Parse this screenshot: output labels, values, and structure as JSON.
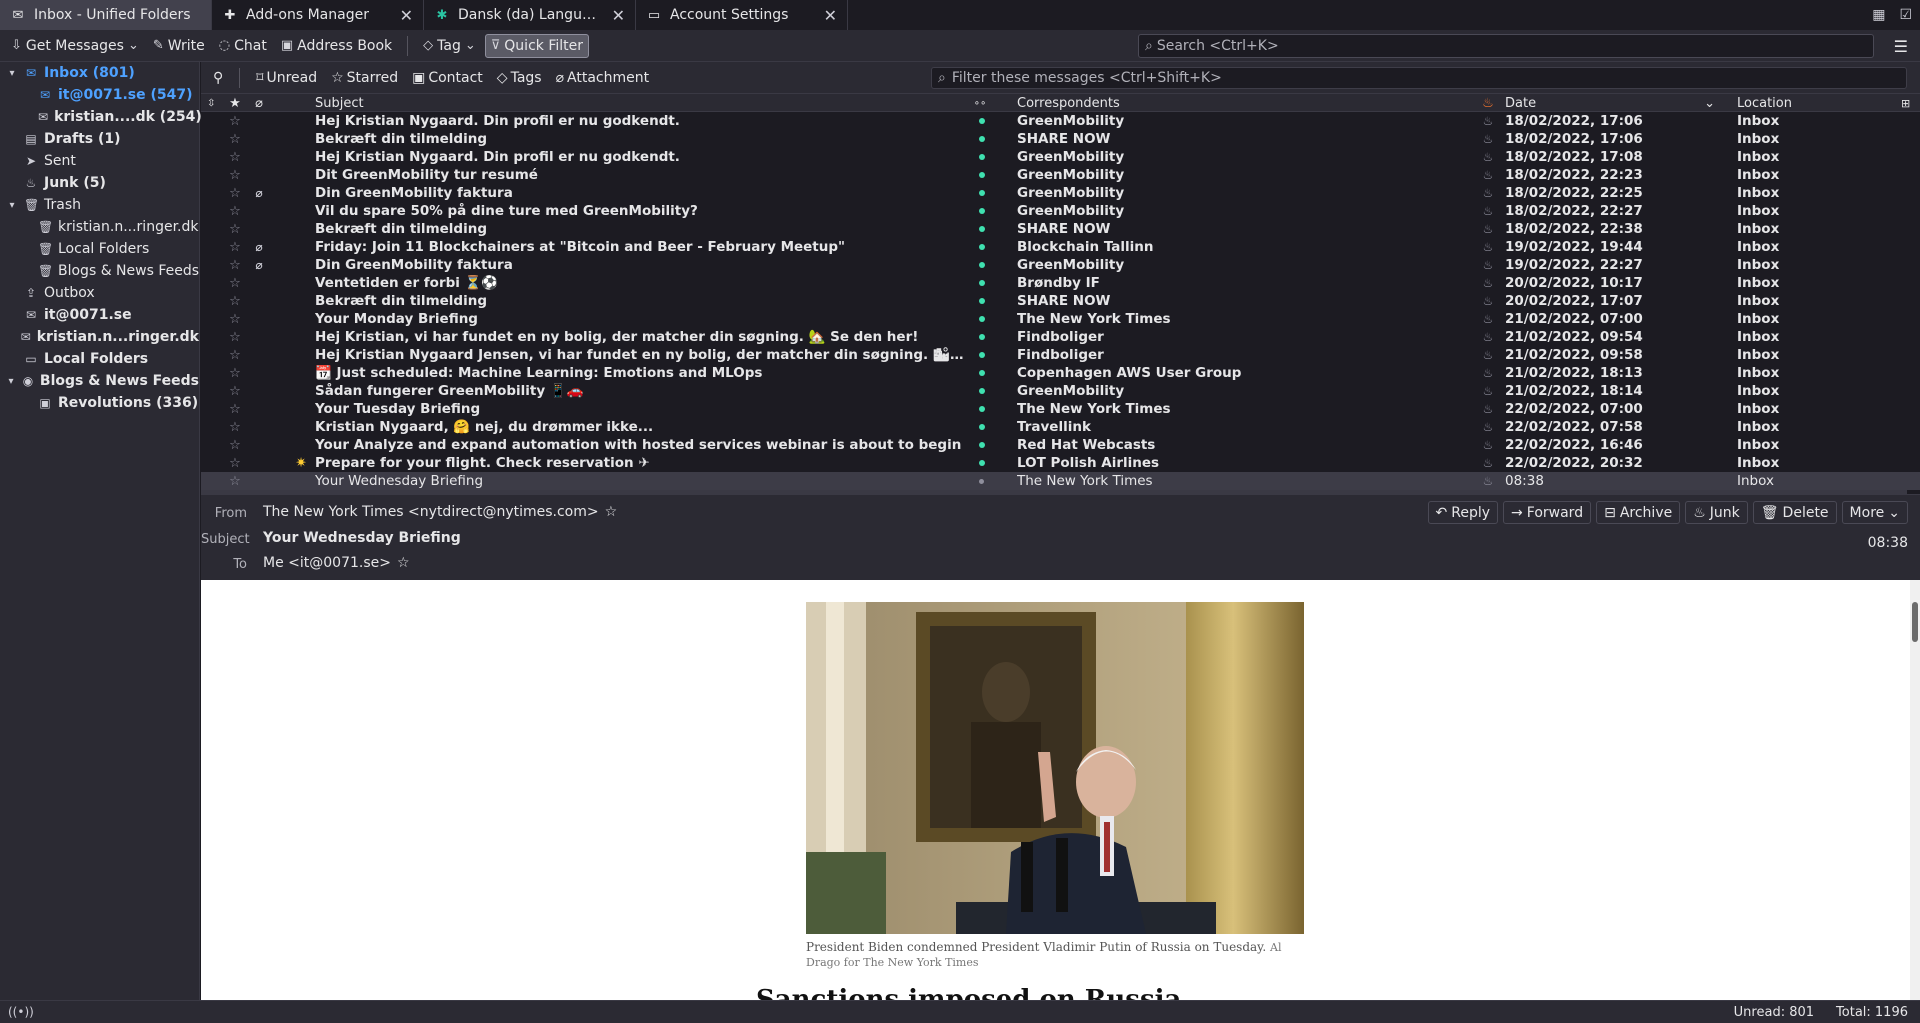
{
  "tabs": [
    {
      "title": "Inbox - Unified Folders",
      "icon": "inbox-icon",
      "active": true
    },
    {
      "title": "Add-ons Manager",
      "icon": "puzzle-icon",
      "active": false
    },
    {
      "title": "Dansk (da) Language Pack",
      "icon": "language-pack-icon",
      "active": false
    },
    {
      "title": "Account Settings",
      "icon": "settings-page-icon",
      "active": false
    }
  ],
  "toolbar": {
    "get_messages": "Get Messages",
    "write": "Write",
    "chat": "Chat",
    "address_book": "Address Book",
    "tag": "Tag",
    "quick_filter": "Quick Filter",
    "search_placeholder": "Search <Ctrl+K>"
  },
  "folders": [
    {
      "label": "Inbox (801)",
      "indent": 0,
      "twisty": "▾",
      "icon": "✉",
      "bold": true,
      "selected": true
    },
    {
      "label": "it@0071.se (547)",
      "indent": 1,
      "twisty": "",
      "icon": "✉",
      "bold": true,
      "selected": true
    },
    {
      "label": "kristian....dk (254)",
      "indent": 1,
      "twisty": "",
      "icon": "✉",
      "bold": true,
      "selected": false
    },
    {
      "label": "Drafts (1)",
      "indent": 0,
      "twisty": "",
      "icon": "▤",
      "bold": true,
      "selected": false
    },
    {
      "label": "Sent",
      "indent": 0,
      "twisty": "",
      "icon": "➤",
      "bold": false,
      "selected": false
    },
    {
      "label": "Junk (5)",
      "indent": 0,
      "twisty": "",
      "icon": "♨",
      "bold": true,
      "selected": false
    },
    {
      "label": "Trash",
      "indent": 0,
      "twisty": "▾",
      "icon": "🗑",
      "bold": false,
      "selected": false
    },
    {
      "label": "kristian.n...ringer.dk",
      "indent": 1,
      "twisty": "",
      "icon": "🗑",
      "bold": false,
      "selected": false
    },
    {
      "label": "Local Folders",
      "indent": 1,
      "twisty": "",
      "icon": "🗑",
      "bold": false,
      "selected": false
    },
    {
      "label": "Blogs & News Feeds",
      "indent": 1,
      "twisty": "",
      "icon": "🗑",
      "bold": false,
      "selected": false
    },
    {
      "label": "Outbox",
      "indent": 0,
      "twisty": "",
      "icon": "⇪",
      "bold": false,
      "selected": false
    },
    {
      "label": "it@0071.se",
      "indent": 0,
      "twisty": "",
      "icon": "✉",
      "bold": true,
      "selected": false
    },
    {
      "label": "kristian.n...ringer.dk",
      "indent": 0,
      "twisty": "",
      "icon": "✉",
      "bold": true,
      "selected": false
    },
    {
      "label": "Local Folders",
      "indent": 0,
      "twisty": "",
      "icon": "▭",
      "bold": true,
      "selected": false
    },
    {
      "label": "Blogs & News Feeds",
      "indent": 0,
      "twisty": "▾",
      "icon": "◉",
      "bold": true,
      "selected": false
    },
    {
      "label": "Revolutions (336)",
      "indent": 1,
      "twisty": "",
      "icon": "▣",
      "bold": true,
      "selected": false
    }
  ],
  "quick_filter": {
    "unread": "Unread",
    "starred": "Starred",
    "contact": "Contact",
    "tags": "Tags",
    "attachment": "Attachment",
    "filter_placeholder": "Filter these messages <Ctrl+Shift+K>"
  },
  "columns": {
    "subject": "Subject",
    "correspondents": "Correspondents",
    "date": "Date",
    "location": "Location"
  },
  "messages": [
    {
      "subject": "Hej Kristian Nygaard. Din profil er nu godkendt.",
      "correspondent": "GreenMobility",
      "date": "18/02/2022, 17:06",
      "location": "Inbox",
      "unread": true,
      "attachment": false,
      "flag": ""
    },
    {
      "subject": "Bekræft din tilmelding",
      "correspondent": "SHARE NOW",
      "date": "18/02/2022, 17:06",
      "location": "Inbox",
      "unread": true,
      "attachment": false,
      "flag": ""
    },
    {
      "subject": "Hej Kristian Nygaard. Din profil er nu godkendt.",
      "correspondent": "GreenMobility",
      "date": "18/02/2022, 17:08",
      "location": "Inbox",
      "unread": true,
      "attachment": false,
      "flag": ""
    },
    {
      "subject": "Dit GreenMobility tur resumé",
      "correspondent": "GreenMobility",
      "date": "18/02/2022, 22:23",
      "location": "Inbox",
      "unread": true,
      "attachment": false,
      "flag": ""
    },
    {
      "subject": "Din GreenMobility faktura",
      "correspondent": "GreenMobility",
      "date": "18/02/2022, 22:25",
      "location": "Inbox",
      "unread": true,
      "attachment": true,
      "flag": ""
    },
    {
      "subject": "Vil du spare 50% på dine ture med GreenMobility?",
      "correspondent": "GreenMobility",
      "date": "18/02/2022, 22:27",
      "location": "Inbox",
      "unread": true,
      "attachment": false,
      "flag": ""
    },
    {
      "subject": "Bekræft din tilmelding",
      "correspondent": "SHARE NOW",
      "date": "18/02/2022, 22:38",
      "location": "Inbox",
      "unread": true,
      "attachment": false,
      "flag": ""
    },
    {
      "subject": "Friday: Join 11 Blockchainers at \"Bitcoin and Beer - February Meetup\"",
      "correspondent": "Blockchain Tallinn",
      "date": "19/02/2022, 19:44",
      "location": "Inbox",
      "unread": true,
      "attachment": true,
      "flag": ""
    },
    {
      "subject": "Din GreenMobility faktura",
      "correspondent": "GreenMobility",
      "date": "19/02/2022, 22:27",
      "location": "Inbox",
      "unread": true,
      "attachment": true,
      "flag": ""
    },
    {
      "subject": "Ventetiden er forbi ⏳⚽",
      "correspondent": "Brøndby IF",
      "date": "20/02/2022, 10:17",
      "location": "Inbox",
      "unread": true,
      "attachment": false,
      "flag": ""
    },
    {
      "subject": "Bekræft din tilmelding",
      "correspondent": "SHARE NOW",
      "date": "20/02/2022, 17:07",
      "location": "Inbox",
      "unread": true,
      "attachment": false,
      "flag": ""
    },
    {
      "subject": "Your Monday Briefing",
      "correspondent": "The New York Times",
      "date": "21/02/2022, 07:00",
      "location": "Inbox",
      "unread": true,
      "attachment": false,
      "flag": ""
    },
    {
      "subject": "Hej Kristian, vi har fundet en ny bolig, der matcher din søgning. 🏡 Se den her!",
      "correspondent": "Findboliger",
      "date": "21/02/2022, 09:54",
      "location": "Inbox",
      "unread": true,
      "attachment": false,
      "flag": ""
    },
    {
      "subject": "Hej Kristian Nygaard Jensen, vi har fundet en ny bolig, der matcher din søgning. 🏙…",
      "correspondent": "Findboliger",
      "date": "21/02/2022, 09:58",
      "location": "Inbox",
      "unread": true,
      "attachment": false,
      "flag": ""
    },
    {
      "subject": "📆 Just scheduled: Machine Learning: Emotions and MLOps",
      "correspondent": "Copenhagen AWS User Group",
      "date": "21/02/2022, 18:13",
      "location": "Inbox",
      "unread": true,
      "attachment": false,
      "flag": ""
    },
    {
      "subject": "Sådan fungerer GreenMobility 📱🚗",
      "correspondent": "GreenMobility",
      "date": "21/02/2022, 18:14",
      "location": "Inbox",
      "unread": true,
      "attachment": false,
      "flag": ""
    },
    {
      "subject": "Your Tuesday Briefing",
      "correspondent": "The New York Times",
      "date": "22/02/2022, 07:00",
      "location": "Inbox",
      "unread": true,
      "attachment": false,
      "flag": ""
    },
    {
      "subject": "Kristian Nygaard, 🤗 nej, du drømmer ikke...",
      "correspondent": "Travellink",
      "date": "22/02/2022, 07:58",
      "location": "Inbox",
      "unread": true,
      "attachment": false,
      "flag": ""
    },
    {
      "subject": "Your Analyze and expand automation with hosted services webinar is about to begin",
      "correspondent": "Red Hat Webcasts",
      "date": "22/02/2022, 16:46",
      "location": "Inbox",
      "unread": true,
      "attachment": false,
      "flag": ""
    },
    {
      "subject": "Prepare for your flight. Check reservation ✈",
      "correspondent": "LOT Polish Airlines",
      "date": "22/02/2022, 20:32",
      "location": "Inbox",
      "unread": true,
      "attachment": false,
      "flag": "✷"
    },
    {
      "subject": "Your Wednesday Briefing",
      "correspondent": "The New York Times",
      "date": "08:38",
      "location": "Inbox",
      "unread": false,
      "attachment": false,
      "flag": "",
      "selected": true
    }
  ],
  "message_header": {
    "from_label": "From",
    "from_value": "The New York Times <nytdirect@nytimes.com>",
    "subject_label": "Subject",
    "subject_value": "Your Wednesday Briefing",
    "to_label": "To",
    "to_value": "Me <it@0071.se>",
    "time": "08:38",
    "buttons": {
      "reply": "Reply",
      "forward": "Forward",
      "archive": "Archive",
      "junk": "Junk",
      "delete": "Delete",
      "more": "More"
    }
  },
  "message_body": {
    "caption": "President Biden condemned President Vladimir Putin of Russia on Tuesday.",
    "credit": "Al Drago for The New York Times",
    "headline_partial": "Sanctions imposed on Russia"
  },
  "statusbar": {
    "unread": "Unread: 801",
    "total": "Total: 1196"
  },
  "colors": {
    "accent": "#4ea1ff",
    "read_dot": "#3fe1b0"
  }
}
